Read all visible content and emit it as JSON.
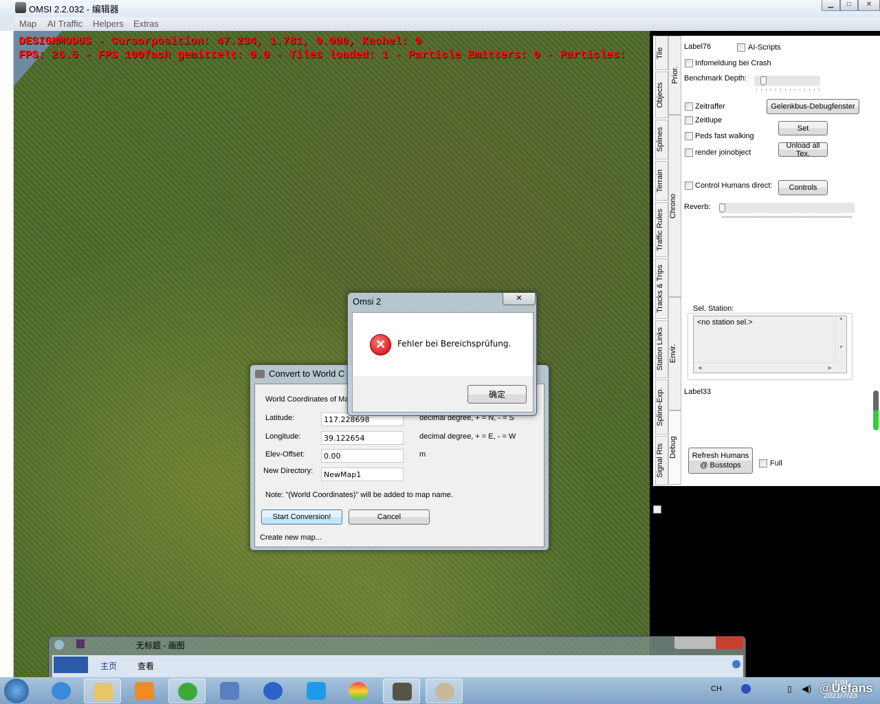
{
  "window": {
    "title": "OMSI 2.2.032 - 编辑器"
  },
  "menu": [
    "Map",
    "AI Traffic",
    "Helpers",
    "Extras"
  ],
  "hud": {
    "line1": "DESIGNMODUS - Cursorposition: 47.234, 1.781, 0.000, Kachel: 0",
    "line2": "FPS: 26.5 - FPS 100fach gemittelt: 0.0 - Tiles loaded: 1 - Particle Emitters: 0 - Particles:"
  },
  "panel": {
    "tabs_outer": [
      "Tile",
      "Objects",
      "Splines",
      "Terrain",
      "Traffic Rules",
      "Tracks & Trips",
      "Station Links",
      "Spline-Exp.",
      "Signal Rts"
    ],
    "tabs_inner": [
      "Prior.",
      "Chrono",
      "Envir.",
      "Debug"
    ],
    "label76": "Label76",
    "ai_scripts": "AI-Scripts",
    "infomeldung": "Infomeldung bei Crash",
    "benchmark_depth": "Benchmark Depth:",
    "benchmark_value": 0,
    "zeitraffer": "Zeitraffer",
    "zeitlupe": "Zeitlupe",
    "peds": "Peds fast walking",
    "render_join": "render joinobject",
    "gelenkbus": "Gelenkbus-Debugfenster",
    "set": "Set",
    "unload": "Unload all Tex.",
    "control_humans": "Control Humans direct:",
    "controls": "Controls",
    "reverb": "Reverb:",
    "reverb_value": 0,
    "sel_station": "Sel. Station:",
    "station_item": "<no station sel.>",
    "label33": "Label33",
    "refresh_line1": "Refresh Humans",
    "refresh_line2": "@ Busstops",
    "full": "Full"
  },
  "convert": {
    "title": "Convert to World C",
    "heading": "World Coordinates of Ma",
    "latitude_label": "Latitude:",
    "latitude": "117.228698",
    "latitude_unit": "decimal degree, + = N, - = S",
    "longitude_label": "Longitude:",
    "longitude": "39.122654",
    "longitude_unit": "decimal degree, + = E, - = W",
    "elev_label": "Elev-Offset:",
    "elev": "0.00",
    "elev_unit": "m",
    "dir_label": "New Directory:",
    "dir": "NewMap1",
    "note": "Note: \"(World Coordinates)\" will be added to map name.",
    "start": "Start Conversion!",
    "cancel": "Cancel",
    "status": "Create new map..."
  },
  "msgbox": {
    "title": "Omsi 2",
    "message": "Fehler bei Bereichsprüfung.",
    "ok": "确定",
    "close": "✕"
  },
  "paint": {
    "title": "无标题 - 画图",
    "tab_home": "主页",
    "tab_view": "查看"
  },
  "taskbar": {
    "lang": "CH",
    "time": "1:01",
    "date": "2021/7/23",
    "watermark": "@Uefans"
  }
}
